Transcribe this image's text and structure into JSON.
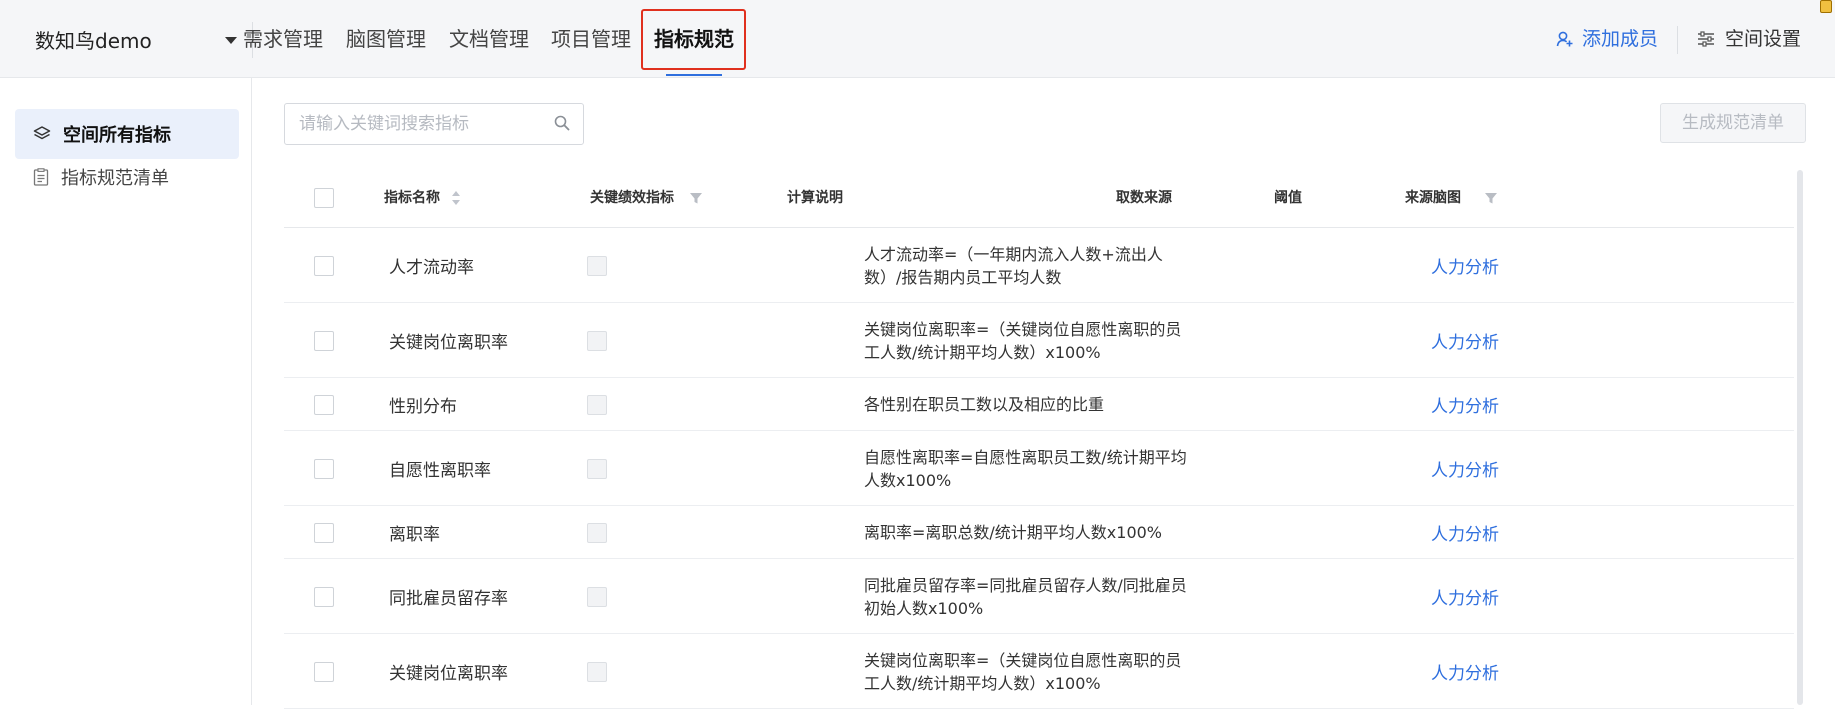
{
  "header": {
    "space_name": "数知鸟demo",
    "nav": [
      "需求管理",
      "脑图管理",
      "文档管理",
      "项目管理",
      "指标规范"
    ],
    "active_nav_index": 4,
    "add_member": "添加成员",
    "space_settings": "空间设置"
  },
  "sidebar": {
    "items": [
      {
        "label": "空间所有指标",
        "icon": "layers-icon",
        "active": true
      },
      {
        "label": "指标规范清单",
        "icon": "document-list-icon",
        "active": false
      }
    ]
  },
  "toolbar": {
    "search_placeholder": "请输入关键词搜索指标",
    "generate_button": "生成规范清单"
  },
  "table": {
    "columns": {
      "name": "指标名称",
      "kpi": "关键绩效指标",
      "desc": "计算说明",
      "source": "取数来源",
      "threshold": "阈值",
      "mindmap": "来源脑图"
    },
    "rows": [
      {
        "name": "人才流动率",
        "desc": "人才流动率=（一年期内流入人数+流出人数）/报告期内员工平均人数",
        "mindmap": "人力分析"
      },
      {
        "name": "关键岗位离职率",
        "desc": "关键岗位离职率=（关键岗位自愿性离职的员工人数/统计期平均人数）x100%",
        "mindmap": "人力分析"
      },
      {
        "name": "性别分布",
        "desc": "各性别在职员工数以及相应的比重",
        "mindmap": "人力分析"
      },
      {
        "name": "自愿性离职率",
        "desc": "自愿性离职率=自愿性离职员工数/统计期平均人数x100%",
        "mindmap": "人力分析"
      },
      {
        "name": "离职率",
        "desc": "离职率=离职总数/统计期平均人数x100%",
        "mindmap": "人力分析"
      },
      {
        "name": "同批雇员留存率",
        "desc": "同批雇员留存率=同批雇员留存人数/同批雇员初始人数x100%",
        "mindmap": "人力分析"
      },
      {
        "name": "关键岗位离职率",
        "desc": "关键岗位离职率=（关键岗位自愿性离职的员工人数/统计期平均人数）x100%",
        "mindmap": "人力分析"
      }
    ]
  },
  "colors": {
    "accent": "#2f6fde",
    "highlight_outline": "#e0301e"
  }
}
